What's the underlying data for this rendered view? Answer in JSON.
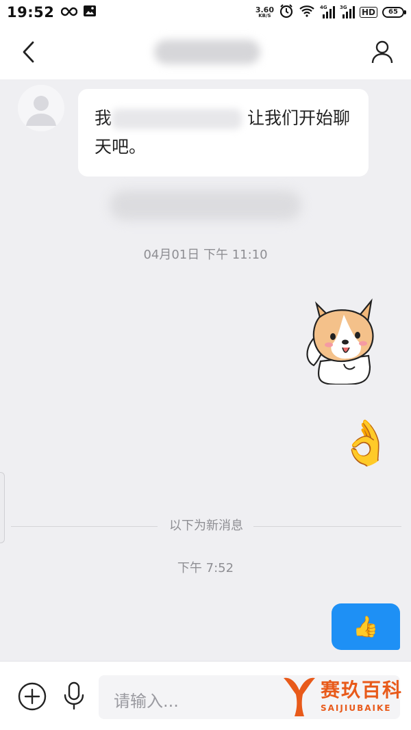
{
  "status_bar": {
    "time": "19:52",
    "net_speed_value": "3.60",
    "net_speed_unit": "KB/S",
    "sim1_tag": "4G",
    "sim2_tag": "3G",
    "hd_label": "HD",
    "battery": "65"
  },
  "header": {
    "back_icon": "chevron-left-icon",
    "profile_icon": "person-icon"
  },
  "messages": {
    "incoming_text_visible": "让我们开始聊天吧。",
    "incoming_prefix_glyph": "我",
    "timestamp_1": "04月01日 下午 11:10",
    "sticker": "corgi-wave-sticker",
    "emoji_1": "👌",
    "new_messages_divider": "以下为新消息",
    "timestamp_2": "下午 7:52",
    "outgoing_emoji": "👍"
  },
  "input_bar": {
    "placeholder": "请输入..."
  },
  "watermark": {
    "name_cn": "赛玖百科",
    "name_en": "SAIJIUBAIKE"
  },
  "colors": {
    "outgoing_bubble": "#1e90f5",
    "chat_background": "#efeff2",
    "watermark": "#e85a1a"
  }
}
